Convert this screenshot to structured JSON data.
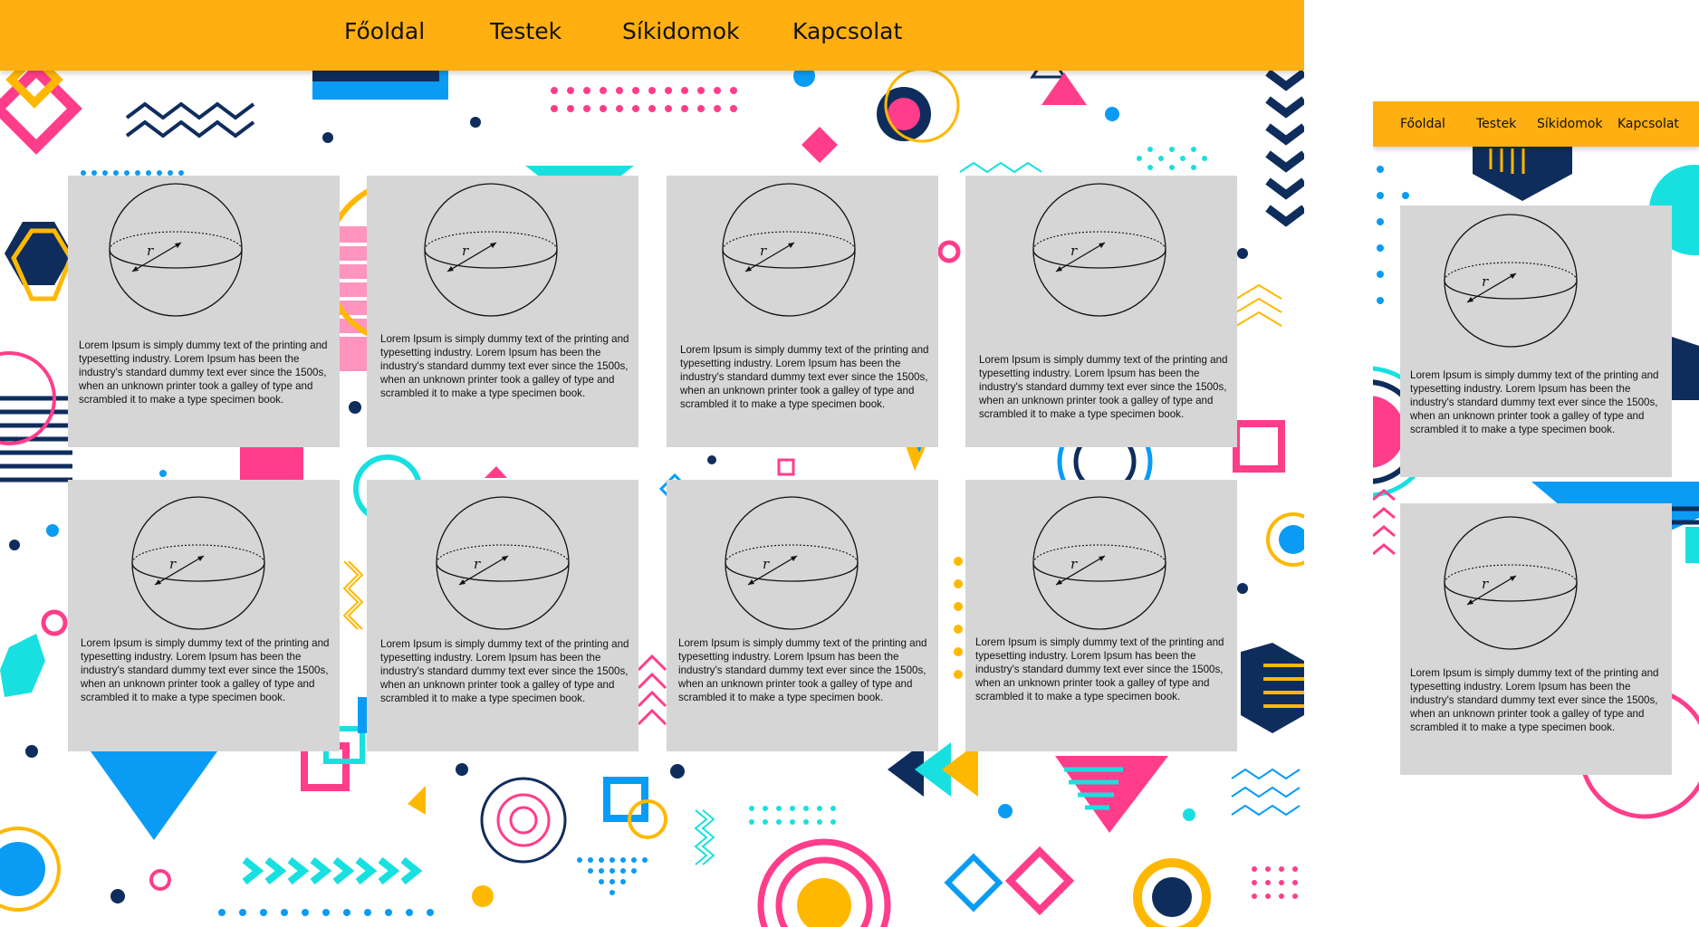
{
  "nav": {
    "links": [
      "Főoldal",
      "Testek",
      "Síkidomok",
      "Kapcsolat"
    ]
  },
  "mobile_nav": {
    "links": [
      "Főoldal",
      "Testek",
      "Síkidomok",
      "Kapcsolat"
    ]
  },
  "cards": [
    {
      "text": "Lorem Ipsum is simply dummy text of the printing and typesetting industry. Lorem Ipsum has been the industry's standard dummy text ever since the 1500s, when an unknown printer took a galley of type and scrambled it to make a type specimen book."
    },
    {
      "text": "Lorem Ipsum is simply dummy text of the printing and typesetting industry. Lorem Ipsum has been the industry's standard dummy text ever since the 1500s, when an unknown printer took a galley of type and scrambled it to make a type specimen book."
    },
    {
      "text": "Lorem Ipsum is simply dummy text of the printing and typesetting industry. Lorem Ipsum has been the industry's standard dummy text ever since the 1500s, when an unknown printer took a galley of type and scrambled it to make a type specimen book."
    },
    {
      "text": "Lorem Ipsum is simply dummy text of the printing and typesetting industry. Lorem Ipsum has been the industry's standard dummy text ever since the 1500s, when an unknown printer took a galley of type and scrambled it to make a type specimen book."
    },
    {
      "text": "Lorem Ipsum is simply dummy text of the printing and typesetting industry. Lorem Ipsum has been the industry's standard dummy text ever since the 1500s, when an unknown printer took a galley of type and scrambled it to make a type specimen book."
    },
    {
      "text": "Lorem Ipsum is simply dummy text of the printing and typesetting industry. Lorem Ipsum has been the industry's standard dummy text ever since the 1500s, when an unknown printer took a galley of type and scrambled it to make a type specimen book."
    },
    {
      "text": "Lorem Ipsum is simply dummy text of the printing and typesetting industry. Lorem Ipsum has been the industry's standard dummy text ever since the 1500s, when an unknown printer took a galley of type and scrambled it to make a type specimen book."
    },
    {
      "text": "Lorem Ipsum is simply dummy text of the printing and typesetting industry. Lorem Ipsum has been the industry's standard dummy text ever since the 1500s, when an unknown printer took a galley of type and scrambled it to make a type specimen book."
    }
  ],
  "mobile_cards": [
    {
      "text": "Lorem Ipsum is simply dummy text of the printing and typesetting industry. Lorem Ipsum has been the industry's standard dummy text ever since the 1500s, when an unknown printer took a galley of type and scrambled it to make a type specimen book."
    },
    {
      "text": "Lorem Ipsum is simply dummy text of the printing and typesetting industry. Lorem Ipsum has been the industry's standard dummy text ever since the 1500s, when an unknown printer took a galley of type and scrambled it to make a type specimen book."
    }
  ],
  "sphere_label": "r",
  "colors": {
    "nav_bg": "#ffaf10",
    "card_bg": "#d6d6d6",
    "pink": "#ff3d8b",
    "cyan": "#19e0e0",
    "blue": "#0a9cf5",
    "navy": "#0f2d5c",
    "yellow": "#ffb800"
  }
}
